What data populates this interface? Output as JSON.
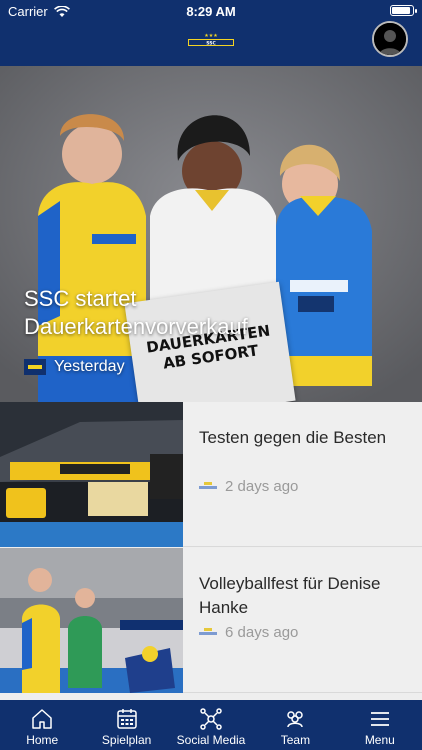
{
  "status": {
    "carrier": "Carrier",
    "time": "8:29 AM"
  },
  "header": {
    "logo": "SSC Palmberg Schwerin"
  },
  "hero": {
    "title": "SSC startet Dauerkartenvorverkauf",
    "date": "Yesterday",
    "sign_text": "DAUERKARTEN\nAB SOFORT"
  },
  "news": [
    {
      "title": "Testen gegen die Besten",
      "date": "2 days ago"
    },
    {
      "title": "Volleyballfest für Denise Hanke",
      "date": "6 days ago"
    }
  ],
  "tabs": [
    {
      "label": "Home",
      "icon": "home-icon"
    },
    {
      "label": "Spielplan",
      "icon": "calendar-icon"
    },
    {
      "label": "Social Media",
      "icon": "network-icon"
    },
    {
      "label": "Team",
      "icon": "team-icon"
    },
    {
      "label": "Menu",
      "icon": "menu-icon"
    }
  ],
  "colors": {
    "primary": "#10306e",
    "accent_yellow": "#f3d323",
    "accent_blue": "#2f6fd6"
  }
}
